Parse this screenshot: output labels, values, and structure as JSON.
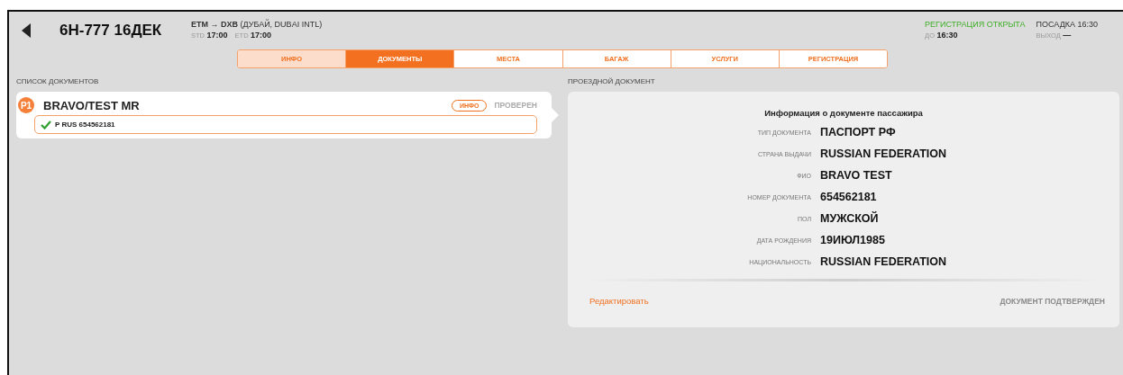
{
  "header": {
    "flight": "6Н-777 16ДЕК",
    "route": "ETM → DXB",
    "destination": "(ДУБАЙ, DUBAI INTL)",
    "std_label": "STD",
    "std": "17:00",
    "etd_label": "ETD",
    "etd": "17:00",
    "checkin_status": "РЕГИСТРАЦИЯ ОТКРЫТА",
    "checkin_until_label": "ДО",
    "checkin_until": "16:30",
    "boarding": "ПОСАДКА 16:30",
    "gate_label": "ВЫХОД",
    "gate": "—"
  },
  "tabs": [
    {
      "label": "ИНФО",
      "selected": false,
      "visited": true
    },
    {
      "label": "ДОКУМЕНТЫ",
      "selected": true,
      "visited": false
    },
    {
      "label": "МЕСТА",
      "selected": false,
      "visited": false
    },
    {
      "label": "БАГАЖ",
      "selected": false,
      "visited": false
    },
    {
      "label": "УСЛУГИ",
      "selected": false,
      "visited": false
    },
    {
      "label": "РЕГИСТРАЦИЯ",
      "selected": false,
      "visited": false
    }
  ],
  "documents_list": {
    "title": "СПИСОК ДОКУМЕНТОВ",
    "passengers": [
      {
        "badge": "P1",
        "name": "BRAVO/TEST MR",
        "info_button": "ИНФО",
        "status": "ПРОВЕРЕН",
        "selected": true,
        "documents": [
          {
            "text": "P RUS 654562181",
            "verified": true
          }
        ]
      }
    ]
  },
  "travel_document": {
    "title": "ПРОЕЗДНОЙ ДОКУМЕНТ",
    "heading": "Информация о документе пассажира",
    "fields": [
      {
        "label": "ТИП ДОКУМЕНТА",
        "value": "ПАСПОРТ РФ"
      },
      {
        "label": "СТРАНА ВЫДАЧИ",
        "value": "RUSSIAN FEDERATION"
      },
      {
        "label": "ФИО",
        "value": "BRAVO TEST"
      },
      {
        "label": "НОМЕР ДОКУМЕНТА",
        "value": "654562181"
      },
      {
        "label": "ПОЛ",
        "value": "МУЖСКОЙ"
      },
      {
        "label": "ДАТА РОЖДЕНИЯ",
        "value": "19ИЮЛ1985"
      },
      {
        "label": "НАЦИОНАЛЬНОСТЬ",
        "value": "RUSSIAN FEDERATION"
      }
    ],
    "edit_link": "Редактировать",
    "confirm_button": "ДОКУМЕНТ ПОДТВЕРЖДЕН",
    "confirm_disabled": true
  }
}
